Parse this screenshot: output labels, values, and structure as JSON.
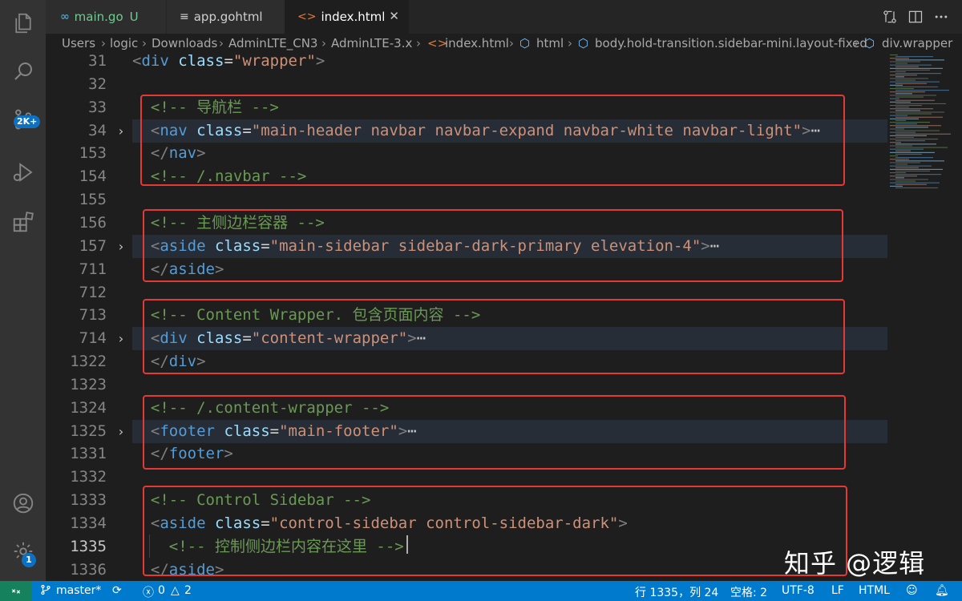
{
  "tabs": [
    {
      "icon": "go-icon",
      "label": "main.go",
      "status": "U"
    },
    {
      "icon": "file-lines-icon",
      "label": "app.gohtml"
    },
    {
      "icon": "html-icon",
      "label": "index.html",
      "close": "✕"
    }
  ],
  "breadcrumb": {
    "folders": [
      "Users",
      "logic",
      "Downloads",
      "AdminLTE_CN3",
      "AdminLTE-3.x"
    ],
    "file": "index.html",
    "symbols": [
      "html",
      "body.hold-transition.sidebar-mini.layout-fixed",
      "div.wrapper"
    ]
  },
  "activity": {
    "scm_badge": "2K+",
    "settings_badge": "1"
  },
  "editor": {
    "lines": [
      {
        "ln": "31",
        "fold": false,
        "html": "<span class=\"pn\">&lt;</span><span class=\"tg\">div</span> <span class=\"at\">class</span>=<span class=\"st\">\"wrapper\"</span><span class=\"pn\">&gt;</span>"
      },
      {
        "ln": "32",
        "fold": false,
        "html": ""
      },
      {
        "ln": "33",
        "fold": false,
        "html": "  <span class=\"cm\">&lt;!-- 导航栏 --&gt;</span>"
      },
      {
        "ln": "34",
        "fold": true,
        "hl": true,
        "html": "  <span class=\"pn\">&lt;</span><span class=\"tg\">nav</span> <span class=\"at\">class</span>=<span class=\"st\">\"main-header navbar navbar-expand navbar-white navbar-light\"</span><span class=\"pn\">&gt;</span><span class=\"el\">⋯</span>"
      },
      {
        "ln": "153",
        "fold": false,
        "html": "  <span class=\"pn\">&lt;/</span><span class=\"tg\">nav</span><span class=\"pn\">&gt;</span>"
      },
      {
        "ln": "154",
        "fold": false,
        "html": "  <span class=\"cm\">&lt;!-- /.navbar --&gt;</span>"
      },
      {
        "ln": "155",
        "fold": false,
        "html": ""
      },
      {
        "ln": "156",
        "fold": false,
        "html": "  <span class=\"cm\">&lt;!-- 主侧边栏容器 --&gt;</span>"
      },
      {
        "ln": "157",
        "fold": true,
        "hl": true,
        "html": "  <span class=\"pn\">&lt;</span><span class=\"tg\">aside</span> <span class=\"at\">class</span>=<span class=\"st\">\"main-sidebar sidebar-dark-primary elevation-4\"</span><span class=\"pn\">&gt;</span><span class=\"el\">⋯</span>"
      },
      {
        "ln": "711",
        "fold": false,
        "html": "  <span class=\"pn\">&lt;/</span><span class=\"tg\">aside</span><span class=\"pn\">&gt;</span>"
      },
      {
        "ln": "712",
        "fold": false,
        "html": ""
      },
      {
        "ln": "713",
        "fold": false,
        "html": "  <span class=\"cm\">&lt;!-- Content Wrapper. 包含页面内容 --&gt;</span>"
      },
      {
        "ln": "714",
        "fold": true,
        "hl": true,
        "html": "  <span class=\"pn\">&lt;</span><span class=\"tg\">div</span> <span class=\"at\">class</span>=<span class=\"st\">\"content-wrapper\"</span><span class=\"pn\">&gt;</span><span class=\"el\">⋯</span>"
      },
      {
        "ln": "1322",
        "fold": false,
        "html": "  <span class=\"pn\">&lt;/</span><span class=\"tg\">div</span><span class=\"pn\">&gt;</span>"
      },
      {
        "ln": "1323",
        "fold": false,
        "html": ""
      },
      {
        "ln": "1324",
        "fold": false,
        "html": "  <span class=\"cm\">&lt;!-- /.content-wrapper --&gt;</span>"
      },
      {
        "ln": "1325",
        "fold": true,
        "hl": true,
        "html": "  <span class=\"pn\">&lt;</span><span class=\"tg\">footer</span> <span class=\"at\">class</span>=<span class=\"st\">\"main-footer\"</span><span class=\"pn\">&gt;</span><span class=\"el\">⋯</span>"
      },
      {
        "ln": "1331",
        "fold": false,
        "html": "  <span class=\"pn\">&lt;/</span><span class=\"tg\">footer</span><span class=\"pn\">&gt;</span>"
      },
      {
        "ln": "1332",
        "fold": false,
        "html": ""
      },
      {
        "ln": "1333",
        "fold": false,
        "html": "  <span class=\"cm\">&lt;!-- Control Sidebar --&gt;</span>"
      },
      {
        "ln": "1334",
        "fold": false,
        "html": "  <span class=\"pn\">&lt;</span><span class=\"tg\">aside</span> <span class=\"at\">class</span>=<span class=\"st\">\"control-sidebar control-sidebar-dark\"</span><span class=\"pn\">&gt;</span>"
      },
      {
        "ln": "1335",
        "fold": false,
        "active": true,
        "html": "    <span class=\"cm\">&lt;!-- 控制侧边栏内容在这里 --&gt;</span>"
      },
      {
        "ln": "1336",
        "fold": false,
        "html": "  <span class=\"pn\">&lt;/</span><span class=\"tg\">aside</span><span class=\"pn\">&gt;</span>"
      }
    ]
  },
  "watermark": "知乎 @逻辑",
  "statusbar": {
    "branch": "master*",
    "errors": "0",
    "warnings": "2",
    "position": "行 1335，列 24",
    "spaces": "空格: 2",
    "encoding": "UTF-8",
    "eol": "LF",
    "language": "HTML"
  },
  "colors": {
    "activity_bar": "#333333",
    "editor_bg": "#1e1e1e",
    "status_bar": "#007acc",
    "annotation_box": "#e53935"
  }
}
